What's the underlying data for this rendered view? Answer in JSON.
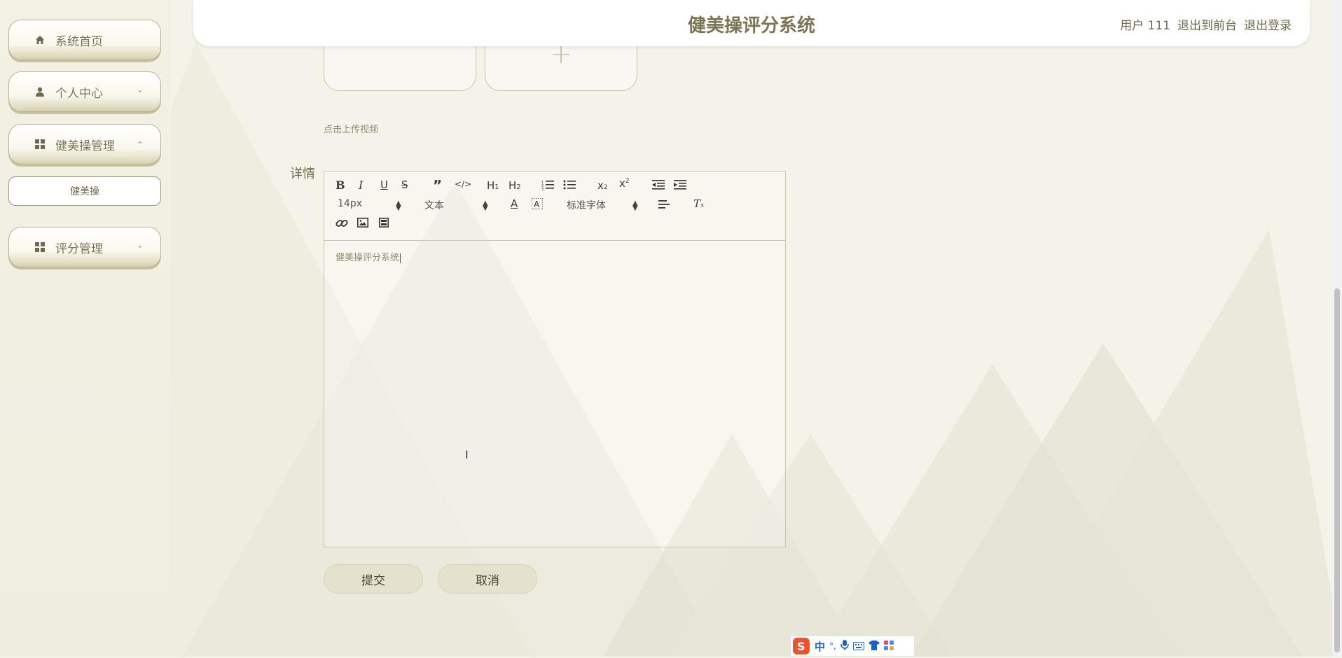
{
  "header": {
    "title": "健美操评分系统",
    "user": "用户 111",
    "to_front": "退出到前台",
    "logout": "退出登录"
  },
  "sidebar": {
    "items": [
      {
        "label": "系统首页",
        "icon": "home-icon"
      },
      {
        "label": "个人中心",
        "icon": "user-icon",
        "chevron": "down"
      },
      {
        "label": "健美操管理",
        "icon": "grid-icon",
        "chevron": "up"
      },
      {
        "label": "评分管理",
        "icon": "grid-icon",
        "chevron": "down"
      }
    ],
    "sub_items": [
      {
        "label": "健美操"
      }
    ]
  },
  "form": {
    "upload_hint": "点击上传视频",
    "detail_label": "详情",
    "editor": {
      "size_select": "14px",
      "header_select": "文本",
      "font_select": "标准字体",
      "content": "健美操评分系统"
    },
    "submit_label": "提交",
    "cancel_label": "取消"
  },
  "ime": {
    "lang": "中",
    "punct": "°,"
  }
}
